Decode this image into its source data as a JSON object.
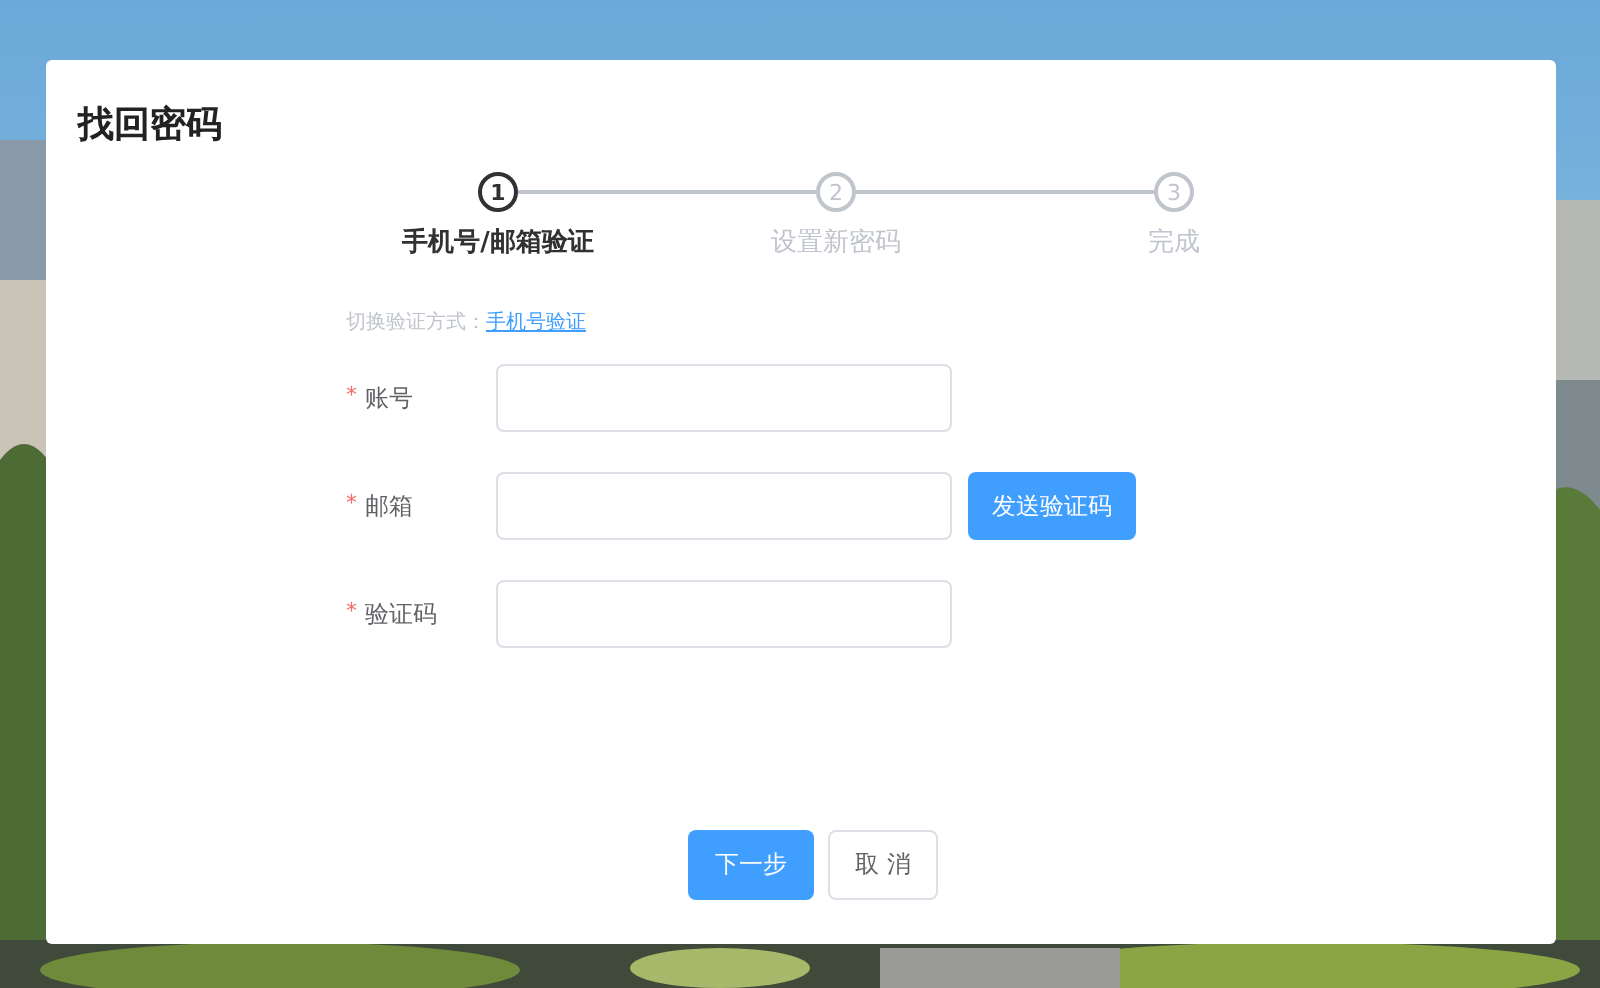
{
  "dialog": {
    "title": "找回密码",
    "steps": [
      {
        "number": "1",
        "label": "手机号/邮箱验证",
        "active": true
      },
      {
        "number": "2",
        "label": "设置新密码",
        "active": false
      },
      {
        "number": "3",
        "label": "完成",
        "active": false
      }
    ],
    "switch_method": {
      "label": "切换验证方式：",
      "link": "手机号验证"
    },
    "fields": [
      {
        "required_mark": "*",
        "label": "账号"
      },
      {
        "required_mark": "*",
        "label": "邮箱",
        "action": "发送验证码"
      },
      {
        "required_mark": "*",
        "label": "验证码"
      }
    ],
    "buttons": [
      {
        "label": "下一步",
        "kind": "primary"
      },
      {
        "label": "取 消",
        "kind": "default"
      }
    ]
  }
}
